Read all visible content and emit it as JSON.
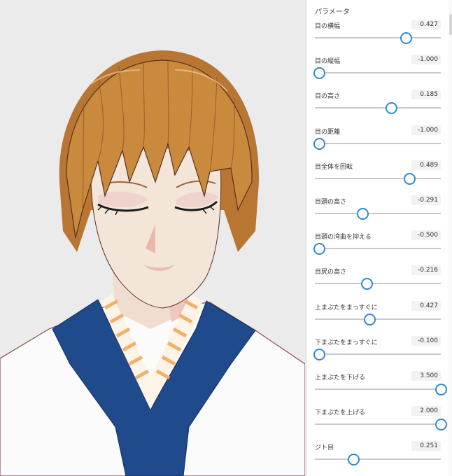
{
  "panel": {
    "title": "パラメータ"
  },
  "params": [
    {
      "label": "目の横幅",
      "value": "0.427",
      "fraction": 0.713
    },
    {
      "label": "目の縦幅",
      "value": "-1.000",
      "fraction": 0.0
    },
    {
      "label": "目の高さ",
      "value": "0.185",
      "fraction": 0.592
    },
    {
      "label": "目の距離",
      "value": "-1.000",
      "fraction": 0.0
    },
    {
      "label": "目全体を回転",
      "value": "0.489",
      "fraction": 0.744
    },
    {
      "label": "目頭の高さ",
      "value": "-0.291",
      "fraction": 0.354
    },
    {
      "label": "目頭の湾曲を抑える",
      "value": "-0.500",
      "fraction": 0.0
    },
    {
      "label": "目尻の高さ",
      "value": "-0.216",
      "fraction": 0.392
    },
    {
      "label": "上まぶたをまっすぐに",
      "value": "0.427",
      "fraction": 0.413
    },
    {
      "label": "下まぶたをまっすぐに",
      "value": "-0.100",
      "fraction": 0.0
    },
    {
      "label": "上まぶたを下げる",
      "value": "3.500",
      "fraction": 1.0
    },
    {
      "label": "下まぶたを上げる",
      "value": "2.000",
      "fraction": 1.0
    },
    {
      "label": "ジト目",
      "value": "0.251",
      "fraction": 0.28
    }
  ],
  "colors": {
    "accent": "#2c8ccf",
    "hair": "#c98a3e",
    "kimono_blue": "#1f4a8c",
    "skin": "#f3e5d8"
  }
}
